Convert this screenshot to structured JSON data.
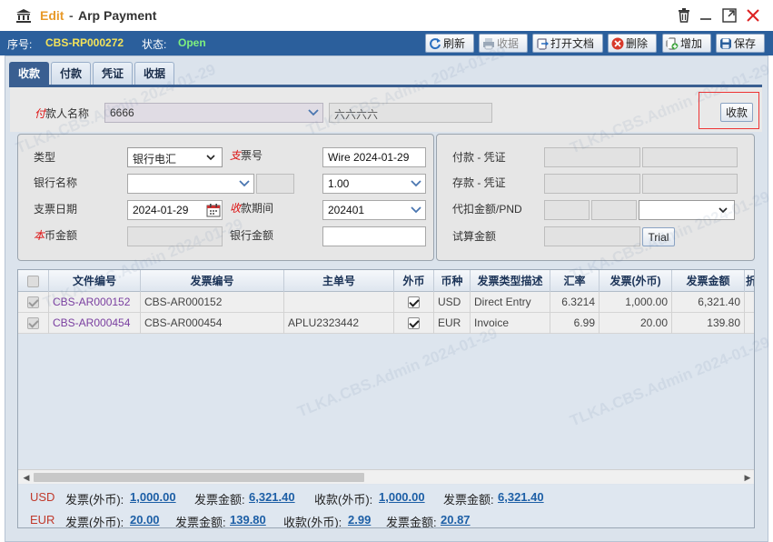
{
  "window": {
    "mode": "Edit",
    "separator": "-",
    "title": "Arp Payment"
  },
  "header": {
    "serial_label": "序号:",
    "serial_value": "CBS-RP000272",
    "status_label": "状态:",
    "status_value": "Open",
    "buttons": {
      "refresh": "刷新",
      "collect": "收据",
      "open_doc": "打开文档",
      "delete": "删除",
      "add": "增加",
      "save": "保存"
    }
  },
  "tabs": [
    "收款",
    "付款",
    "凭证",
    "收据"
  ],
  "payer": {
    "label_mark": "付",
    "label_rest": "款人名称",
    "code": "6666",
    "name": "六六六六",
    "collect_button": "收款"
  },
  "form": {
    "type_label": "类型",
    "type_value": "银行电汇",
    "cheque_mark": "支",
    "cheque_label": "票号",
    "cheque_value": "Wire 2024-01-29",
    "bank_label": "银行名称",
    "bank_value": "",
    "rate_value": "1.00",
    "cheque_date_label": "支票日期",
    "cheque_date_value": "2024-01-29",
    "period_mark": "收",
    "period_label": "款期间",
    "period_value": "202401",
    "base_mark": "本",
    "base_label": "币金额",
    "base_value": "",
    "bank_amount_label": "银行金额",
    "bank_amount_value": ""
  },
  "right_group": {
    "pay_voucher_label": "付款 - 凭证",
    "deposit_voucher_label": "存款 - 凭证",
    "withholding_label": "代扣金额/PND",
    "trial_label": "试算金额",
    "trial_button": "Trial"
  },
  "grid": {
    "columns": [
      "文件编号",
      "发票编号",
      "主单号",
      "外币",
      "币种",
      "发票类型描述",
      "汇率",
      "发票(外币)",
      "发票金额",
      "折"
    ],
    "rows": [
      {
        "checked": true,
        "doc_no": "CBS-AR000152",
        "invoice_no": "CBS-AR000152",
        "master_no": "",
        "foreign": true,
        "currency": "USD",
        "inv_type": "Direct Entry",
        "rate": "6.3214",
        "inv_foreign": "1,000.00",
        "inv_amount": "6,321.40"
      },
      {
        "checked": true,
        "doc_no": "CBS-AR000454",
        "invoice_no": "CBS-AR000454",
        "master_no": "APLU2323442",
        "foreign": true,
        "currency": "EUR",
        "inv_type": "Invoice",
        "rate": "6.99",
        "inv_foreign": "20.00",
        "inv_amount": "139.80"
      }
    ]
  },
  "summary": [
    {
      "currency": "USD",
      "inv_foreign_label": "发票(外币):",
      "inv_foreign": "1,000.00",
      "inv_amount_label": "发票金额:",
      "inv_amount": "6,321.40",
      "rcv_foreign_label": "收款(外币):",
      "rcv_foreign": "1,000.00",
      "rcv_amount_label": "发票金额:",
      "rcv_amount": "6,321.40"
    },
    {
      "currency": "EUR",
      "inv_foreign_label": "发票(外币):",
      "inv_foreign": "20.00",
      "inv_amount_label": "发票金额:",
      "inv_amount": "139.80",
      "rcv_foreign_label": "收款(外币):",
      "rcv_foreign": "2.99",
      "rcv_amount_label": "发票金额:",
      "rcv_amount": "20.87"
    }
  ],
  "watermark": "TLKA.CBS.Admin 2024-01-29",
  "colors": {
    "header_bg": "#2b5f9c",
    "active_tab": "#3a5f91",
    "link": "#1d5fa6",
    "required_mark": "#d11"
  }
}
